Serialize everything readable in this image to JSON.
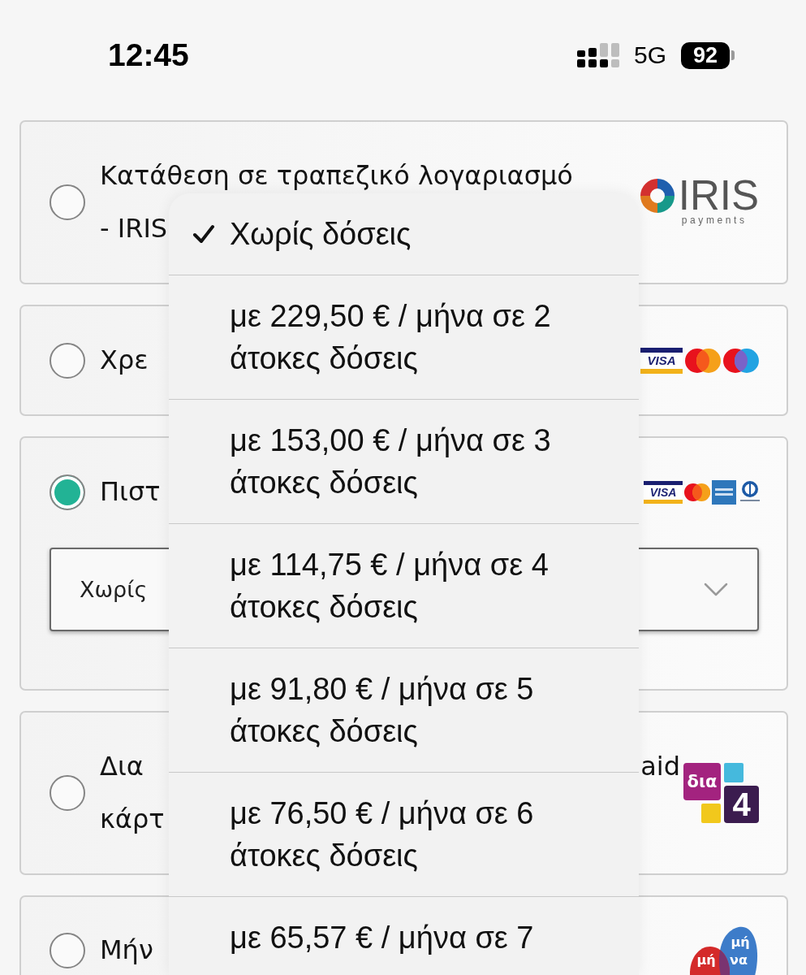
{
  "status_bar": {
    "time": "12:45",
    "network": "5G",
    "battery": "92"
  },
  "payment_methods": [
    {
      "kind": "iris",
      "selected": false,
      "label_lines": [
        "Κατάθεση σε τραπεζικό λογαριασμό",
        "- IRIS"
      ],
      "logo_words": [
        "IRIS",
        "payments"
      ]
    },
    {
      "kind": "debitcards",
      "selected": false,
      "label_lines": [
        "Χρε"
      ],
      "logo_words": [
        "VISA"
      ]
    },
    {
      "kind": "creditcards",
      "selected": true,
      "label_lines": [
        "Πιστ"
      ],
      "logo_words": [
        "VISA"
      ],
      "select": {
        "value": "Χωρίς"
      }
    },
    {
      "kind": "dia4",
      "selected": false,
      "label_lines": [
        "Δια",
        "κάρτ"
      ],
      "label_right": "aid",
      "logo_words": [
        "δια",
        "4"
      ]
    },
    {
      "kind": "minava",
      "selected": false,
      "label_lines": [
        "Μήν"
      ],
      "logo_words": [
        "μή",
        "μή",
        "να"
      ]
    }
  ],
  "installments_menu": {
    "options": [
      {
        "text": "Χωρίς δόσεις",
        "selected": true
      },
      {
        "text": "με 229,50 € / μήνα σε 2 άτοκες δόσεις",
        "selected": false
      },
      {
        "text": "με 153,00 € / μήνα σε 3 άτοκες δόσεις",
        "selected": false
      },
      {
        "text": "με 114,75 € / μήνα σε 4 άτοκες δόσεις",
        "selected": false
      },
      {
        "text": "με 91,80 € / μήνα σε 5 άτοκες δόσεις",
        "selected": false
      },
      {
        "text": "με 76,50 € / μήνα σε 6 άτοκες δόσεις",
        "selected": false
      },
      {
        "text": "με 65,57 € / μήνα σε 7",
        "selected": false
      }
    ]
  }
}
